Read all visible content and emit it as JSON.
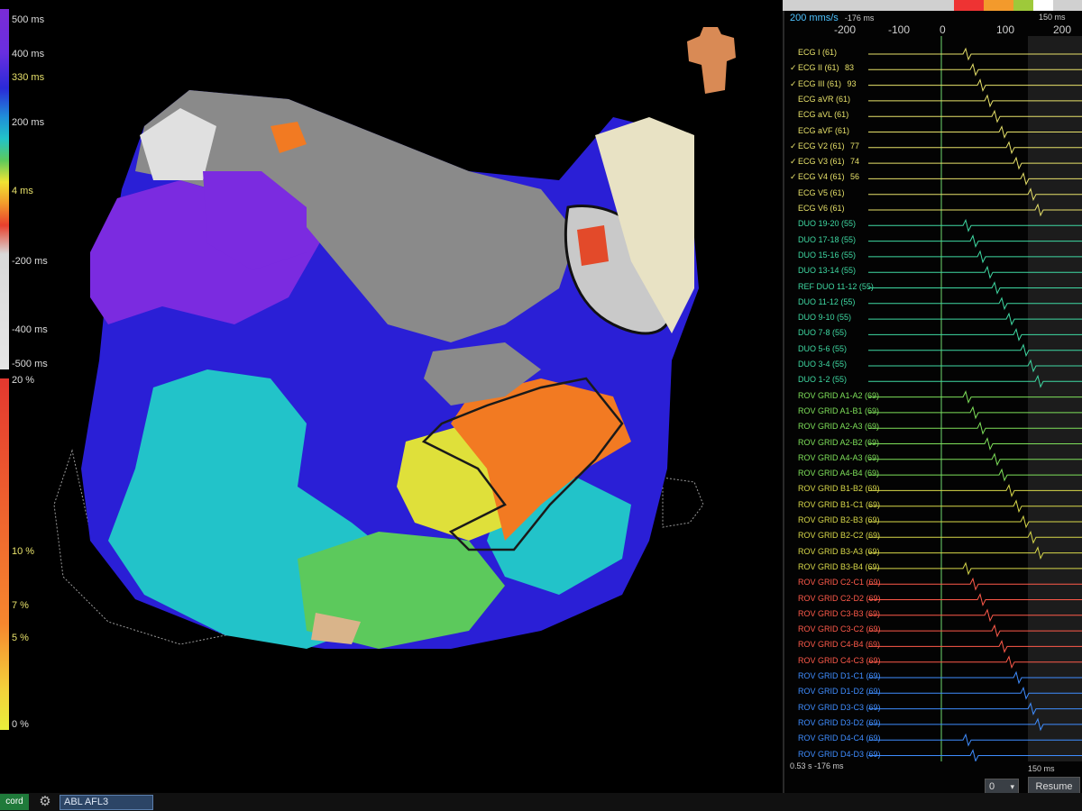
{
  "activation_scale": {
    "labels": [
      "500 ms",
      "400 ms",
      "330 ms",
      "200 ms",
      "4 ms",
      "-200 ms",
      "-400 ms",
      "-500 ms"
    ]
  },
  "percent_scale": {
    "labels": [
      "20 %",
      "10 %",
      "7 %",
      "5 %",
      "0 %"
    ]
  },
  "right_panel": {
    "speed": "200 mms/s",
    "speed_offset": "-176 ms",
    "top_ms": "150 ms",
    "axis_ticks": [
      "-200",
      "-100",
      "0",
      "100",
      "200"
    ],
    "bottom_time": "0.53 s  -176 ms",
    "bottom_ms": "150 ms",
    "traces": [
      {
        "label": "ECG I (61)",
        "value": "",
        "checked": false,
        "color": "#e7e16a"
      },
      {
        "label": "ECG II (61)",
        "value": "83",
        "checked": true,
        "color": "#e7e16a"
      },
      {
        "label": "ECG III (61)",
        "value": "93",
        "checked": true,
        "color": "#e7e16a"
      },
      {
        "label": "ECG aVR (61)",
        "value": "",
        "checked": false,
        "color": "#e7e16a"
      },
      {
        "label": "ECG aVL (61)",
        "value": "",
        "checked": false,
        "color": "#e7e16a"
      },
      {
        "label": "ECG aVF (61)",
        "value": "",
        "checked": false,
        "color": "#e7e16a"
      },
      {
        "label": "ECG V2 (61)",
        "value": "77",
        "checked": true,
        "color": "#e7e16a"
      },
      {
        "label": "ECG V3 (61)",
        "value": "74",
        "checked": true,
        "color": "#e7e16a"
      },
      {
        "label": "ECG V4 (61)",
        "value": "56",
        "checked": true,
        "color": "#e7e16a"
      },
      {
        "label": "ECG V5 (61)",
        "value": "",
        "checked": false,
        "color": "#e7e16a"
      },
      {
        "label": "ECG V6 (61)",
        "value": "",
        "checked": false,
        "color": "#e7e16a"
      },
      {
        "label": "DUO 19-20 (55)",
        "value": "",
        "checked": false,
        "color": "#3fd9a3"
      },
      {
        "label": "DUO 17-18 (55)",
        "value": "",
        "checked": false,
        "color": "#3fd9a3"
      },
      {
        "label": "DUO 15-16 (55)",
        "value": "",
        "checked": false,
        "color": "#3fd9a3"
      },
      {
        "label": "DUO 13-14 (55)",
        "value": "",
        "checked": false,
        "color": "#3fd9a3"
      },
      {
        "label": "REF DUO 11-12 (55)",
        "value": "",
        "checked": false,
        "color": "#3fd9a3"
      },
      {
        "label": "DUO 11-12 (55)",
        "value": "",
        "checked": false,
        "color": "#3fd9a3"
      },
      {
        "label": "DUO 9-10 (55)",
        "value": "",
        "checked": false,
        "color": "#3fd9a3"
      },
      {
        "label": "DUO 7-8 (55)",
        "value": "",
        "checked": false,
        "color": "#3fd9a3"
      },
      {
        "label": "DUO 5-6 (55)",
        "value": "",
        "checked": false,
        "color": "#3fd9a3"
      },
      {
        "label": "DUO 3-4 (55)",
        "value": "",
        "checked": false,
        "color": "#3fd9a3"
      },
      {
        "label": "DUO 1-2 (55)",
        "value": "",
        "checked": false,
        "color": "#3fd9a3"
      },
      {
        "label": "ROV GRID A1-A2 (69)",
        "value": "",
        "checked": false,
        "color": "#7ee05a"
      },
      {
        "label": "ROV GRID A1-B1 (69)",
        "value": "",
        "checked": false,
        "color": "#7ee05a"
      },
      {
        "label": "ROV GRID A2-A3 (69)",
        "value": "",
        "checked": false,
        "color": "#7ee05a"
      },
      {
        "label": "ROV GRID A2-B2 (69)",
        "value": "",
        "checked": false,
        "color": "#7ee05a"
      },
      {
        "label": "ROV GRID A4-A3 (69)",
        "value": "",
        "checked": false,
        "color": "#7ee05a"
      },
      {
        "label": "ROV GRID A4-B4 (69)",
        "value": "",
        "checked": false,
        "color": "#7ee05a"
      },
      {
        "label": "ROV GRID B1-B2 (69)",
        "value": "",
        "checked": false,
        "color": "#d8d84a"
      },
      {
        "label": "ROV GRID B1-C1 (69)",
        "value": "",
        "checked": false,
        "color": "#d8d84a"
      },
      {
        "label": "ROV GRID B2-B3 (69)",
        "value": "",
        "checked": false,
        "color": "#d8d84a"
      },
      {
        "label": "ROV GRID B2-C2 (69)",
        "value": "",
        "checked": false,
        "color": "#d8d84a"
      },
      {
        "label": "ROV GRID B3-A3 (69)",
        "value": "",
        "checked": false,
        "color": "#d8d84a"
      },
      {
        "label": "ROV GRID B3-B4 (69)",
        "value": "",
        "checked": false,
        "color": "#d8d84a"
      },
      {
        "label": "ROV GRID C2-C1 (69)",
        "value": "",
        "checked": false,
        "color": "#ff5a4a"
      },
      {
        "label": "ROV GRID C2-D2 (69)",
        "value": "",
        "checked": false,
        "color": "#ff5a4a"
      },
      {
        "label": "ROV GRID C3-B3 (69)",
        "value": "",
        "checked": false,
        "color": "#ff5a4a"
      },
      {
        "label": "ROV GRID C3-C2 (69)",
        "value": "",
        "checked": false,
        "color": "#ff5a4a"
      },
      {
        "label": "ROV GRID C4-B4 (69)",
        "value": "",
        "checked": false,
        "color": "#ff5a4a"
      },
      {
        "label": "ROV GRID C4-C3 (69)",
        "value": "",
        "checked": false,
        "color": "#ff5a4a"
      },
      {
        "label": "ROV GRID D1-C1 (69)",
        "value": "",
        "checked": false,
        "color": "#3f8dff"
      },
      {
        "label": "ROV GRID D1-D2 (69)",
        "value": "",
        "checked": false,
        "color": "#3f8dff"
      },
      {
        "label": "ROV GRID D3-C3 (69)",
        "value": "",
        "checked": false,
        "color": "#3f8dff"
      },
      {
        "label": "ROV GRID D3-D2 (69)",
        "value": "",
        "checked": false,
        "color": "#3f8dff"
      },
      {
        "label": "ROV GRID D4-C4 (69)",
        "value": "",
        "checked": false,
        "color": "#3f8dff"
      },
      {
        "label": "ROV GRID D4-D3 (69)",
        "value": "",
        "checked": false,
        "color": "#3f8dff"
      }
    ]
  },
  "footer": {
    "record_label": "cord",
    "map_name": "ABL AFL3",
    "dropdown_value": "0",
    "resume_label": "Resume"
  }
}
